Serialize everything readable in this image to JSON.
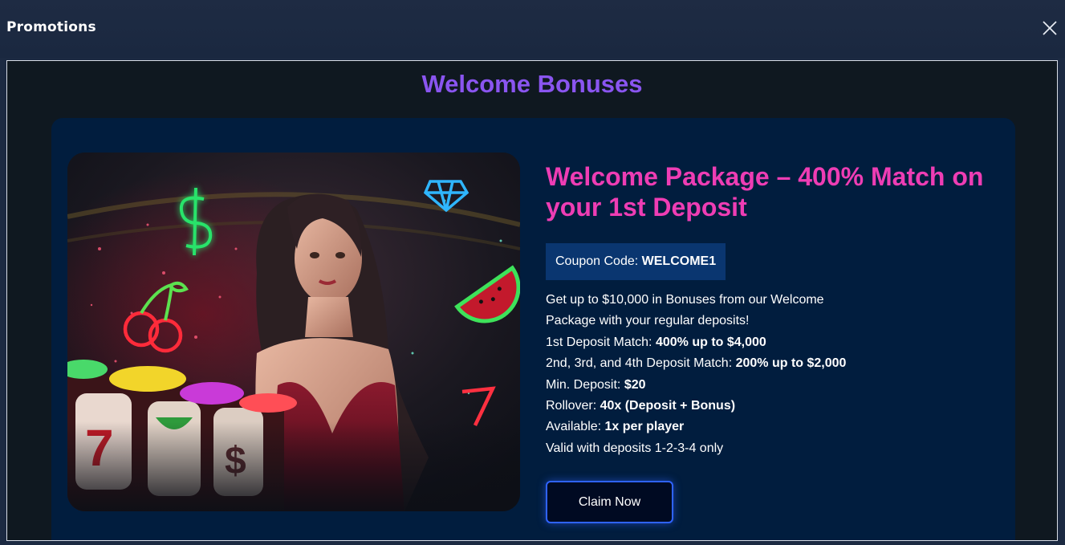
{
  "header": {
    "title": "Promotions"
  },
  "section": {
    "heading": "Welcome Bonuses"
  },
  "promo": {
    "title": "Welcome Package – 400% Match on your 1st Deposit",
    "coupon_label": "Coupon Code: ",
    "coupon_code": "WELCOME1",
    "description_1": "Get up to $10,000 in Bonuses from our Welcome",
    "description_2": "Package with your regular deposits!",
    "details": [
      {
        "label": "1st Deposit Match: ",
        "value": "400% up to $4,000"
      },
      {
        "label": "2nd, 3rd, and 4th Deposit Match: ",
        "value": "200% up to $2,000"
      },
      {
        "label": "Min. Deposit: ",
        "value": "$20"
      },
      {
        "label": "Rollover: ",
        "value": "40x (Deposit + Bonus)"
      },
      {
        "label": "Available: ",
        "value": "1x per player"
      }
    ],
    "validity": "Valid with deposits 1-2-3-4 only",
    "cta_label": "Claim Now"
  },
  "colors": {
    "heading": "#8a55f0",
    "promo_title": "#ee3db4",
    "card_bg": "#011d3e",
    "coupon_bg": "#0a3670",
    "cta_border": "#2f63ff"
  }
}
